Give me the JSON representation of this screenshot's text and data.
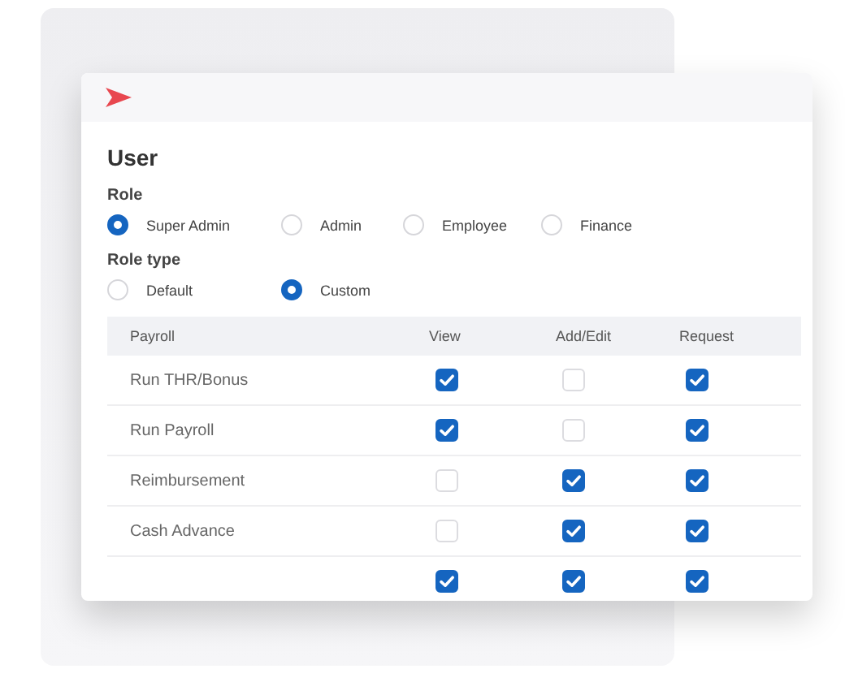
{
  "title": "User",
  "role": {
    "label": "Role",
    "options": [
      {
        "label": "Super Admin",
        "selected": true
      },
      {
        "label": "Admin",
        "selected": false
      },
      {
        "label": "Employee",
        "selected": false
      },
      {
        "label": "Finance",
        "selected": false
      }
    ]
  },
  "role_type": {
    "label": "Role type",
    "options": [
      {
        "label": "Default",
        "selected": false
      },
      {
        "label": "Custom",
        "selected": true
      }
    ]
  },
  "table": {
    "columns": [
      "Payroll",
      "View",
      "Add/Edit",
      "Request"
    ],
    "rows": [
      {
        "name": "Run THR/Bonus",
        "view": true,
        "add_edit": false,
        "request": true
      },
      {
        "name": "Run Payroll",
        "view": true,
        "add_edit": false,
        "request": true
      },
      {
        "name": "Reimbursement",
        "view": false,
        "add_edit": true,
        "request": true
      },
      {
        "name": "Cash Advance",
        "view": false,
        "add_edit": true,
        "request": true
      },
      {
        "view": true,
        "add_edit": true,
        "request": true
      }
    ]
  }
}
